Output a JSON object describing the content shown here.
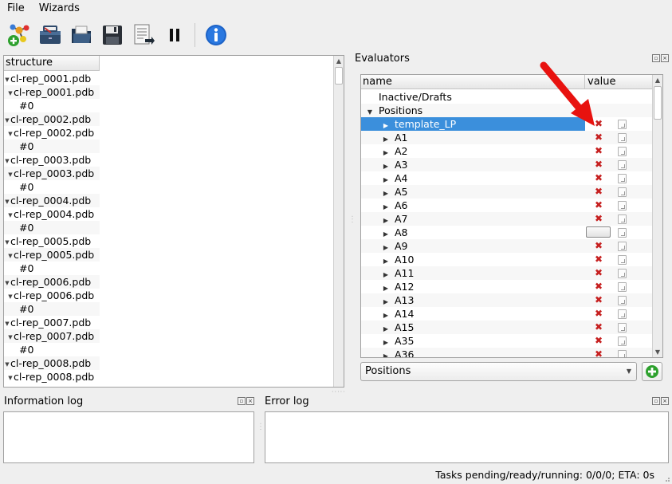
{
  "menu": {
    "file": "File",
    "wizards": "Wizards"
  },
  "toolbar": {
    "icons": [
      "molecule-add-icon",
      "toolbox-icon",
      "folder-open-icon",
      "save-icon",
      "export-icon",
      "pause-icon",
      "info-icon"
    ]
  },
  "structure": {
    "header": "structure",
    "rows": [
      {
        "text": "cl-rep_0001.pdb",
        "level": 0
      },
      {
        "text": "cl-rep_0001.pdb",
        "level": 1
      },
      {
        "text": "#0",
        "level": 2
      },
      {
        "text": "cl-rep_0002.pdb",
        "level": 0
      },
      {
        "text": "cl-rep_0002.pdb",
        "level": 1
      },
      {
        "text": "#0",
        "level": 2
      },
      {
        "text": "cl-rep_0003.pdb",
        "level": 0
      },
      {
        "text": "cl-rep_0003.pdb",
        "level": 1
      },
      {
        "text": "#0",
        "level": 2
      },
      {
        "text": "cl-rep_0004.pdb",
        "level": 0
      },
      {
        "text": "cl-rep_0004.pdb",
        "level": 1
      },
      {
        "text": "#0",
        "level": 2
      },
      {
        "text": "cl-rep_0005.pdb",
        "level": 0
      },
      {
        "text": "cl-rep_0005.pdb",
        "level": 1
      },
      {
        "text": "#0",
        "level": 2
      },
      {
        "text": "cl-rep_0006.pdb",
        "level": 0
      },
      {
        "text": "cl-rep_0006.pdb",
        "level": 1
      },
      {
        "text": "#0",
        "level": 2
      },
      {
        "text": "cl-rep_0007.pdb",
        "level": 0
      },
      {
        "text": "cl-rep_0007.pdb",
        "level": 1
      },
      {
        "text": "#0",
        "level": 2
      },
      {
        "text": "cl-rep_0008.pdb",
        "level": 0
      },
      {
        "text": "cl-rep_0008.pdb",
        "level": 1
      }
    ]
  },
  "evaluators": {
    "title": "Evaluators",
    "col_name": "name",
    "col_value": "value",
    "rows": [
      {
        "text": "Inactive/Drafts",
        "level": 0,
        "expander": "",
        "value": ""
      },
      {
        "text": "Positions",
        "level": 1,
        "expander": "down",
        "value": ""
      },
      {
        "text": "template_LP",
        "level": 2,
        "expander": "right",
        "value": "x",
        "selected": true
      },
      {
        "text": "A1",
        "level": 2,
        "expander": "right",
        "value": "x"
      },
      {
        "text": "A2",
        "level": 2,
        "expander": "right",
        "value": "x"
      },
      {
        "text": "A3",
        "level": 2,
        "expander": "right",
        "value": "x"
      },
      {
        "text": "A4",
        "level": 2,
        "expander": "right",
        "value": "x"
      },
      {
        "text": "A5",
        "level": 2,
        "expander": "right",
        "value": "x"
      },
      {
        "text": "A6",
        "level": 2,
        "expander": "right",
        "value": "x"
      },
      {
        "text": "A7",
        "level": 2,
        "expander": "right",
        "value": "x"
      },
      {
        "text": "A8",
        "level": 2,
        "expander": "right",
        "value": "button"
      },
      {
        "text": "A9",
        "level": 2,
        "expander": "right",
        "value": "x"
      },
      {
        "text": "A10",
        "level": 2,
        "expander": "right",
        "value": "x"
      },
      {
        "text": "A11",
        "level": 2,
        "expander": "right",
        "value": "x"
      },
      {
        "text": "A12",
        "level": 2,
        "expander": "right",
        "value": "x"
      },
      {
        "text": "A13",
        "level": 2,
        "expander": "right",
        "value": "x"
      },
      {
        "text": "A14",
        "level": 2,
        "expander": "right",
        "value": "x"
      },
      {
        "text": "A15",
        "level": 2,
        "expander": "right",
        "value": "x"
      },
      {
        "text": "A35",
        "level": 2,
        "expander": "right",
        "value": "x"
      },
      {
        "text": "A36",
        "level": 2,
        "expander": "right",
        "value": "x"
      }
    ],
    "combo_value": "Positions",
    "arrow_color": "#e8120f"
  },
  "info_log": {
    "title": "Information log"
  },
  "error_log": {
    "title": "Error log"
  },
  "status": {
    "text": "Tasks pending/ready/running: 0/0/0; ETA: 0s"
  }
}
